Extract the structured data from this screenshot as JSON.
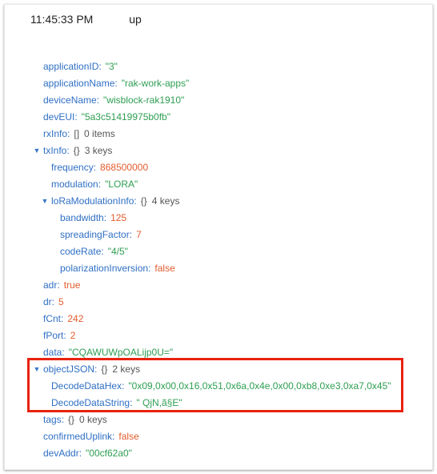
{
  "header": {
    "time": "11:45:33 PM",
    "event": "up"
  },
  "fields": {
    "applicationID": {
      "key": "applicationID",
      "value": "\"3\""
    },
    "applicationName": {
      "key": "applicationName",
      "value": "\"rak-work-apps\""
    },
    "deviceName": {
      "key": "deviceName",
      "value": "\"wisblock-rak1910\""
    },
    "devEUI": {
      "key": "devEUI",
      "value": "\"5a3c51419975b0fb\""
    },
    "rxInfo": {
      "key": "rxInfo",
      "brace": "[]",
      "meta": "0 items"
    },
    "txInfo": {
      "key": "txInfo",
      "brace": "{}",
      "meta": "3 keys"
    },
    "frequency": {
      "key": "frequency",
      "value": "868500000"
    },
    "modulation": {
      "key": "modulation",
      "value": "\"LORA\""
    },
    "loRaModulationInfo": {
      "key": "loRaModulationInfo",
      "brace": "{}",
      "meta": "4 keys"
    },
    "bandwidth": {
      "key": "bandwidth",
      "value": "125"
    },
    "spreadingFactor": {
      "key": "spreadingFactor",
      "value": "7"
    },
    "codeRate": {
      "key": "codeRate",
      "value": "\"4/5\""
    },
    "polarizationInversion": {
      "key": "polarizationInversion",
      "value": "false"
    },
    "adr": {
      "key": "adr",
      "value": "true"
    },
    "dr": {
      "key": "dr",
      "value": "5"
    },
    "fCnt": {
      "key": "fCnt",
      "value": "242"
    },
    "fPort": {
      "key": "fPort",
      "value": "2"
    },
    "data": {
      "key": "data",
      "value": "\"CQAWUWpOALijp0U=\""
    },
    "objectJSON": {
      "key": "objectJSON",
      "brace": "{}",
      "meta": "2 keys"
    },
    "DecodeDataHex": {
      "key": "DecodeDataHex",
      "value": "\"0x09,0x00,0x16,0x51,0x6a,0x4e,0x00,0xb8,0xe3,0xa7,0x45\""
    },
    "DecodeDataString": {
      "key": "DecodeDataString",
      "value": "\" QjN,ã§E\""
    },
    "tags": {
      "key": "tags",
      "brace": "{}",
      "meta": "0 keys"
    },
    "confirmedUplink": {
      "key": "confirmedUplink",
      "value": "false"
    },
    "devAddr": {
      "key": "devAddr",
      "value": "\"00cf62a0\""
    }
  },
  "icons": {
    "expand": "caret-down-icon"
  },
  "colors": {
    "key": "#2f6fc4",
    "string": "#2e9e52",
    "number": "#e35b2d",
    "highlight_border": "#e8220f"
  }
}
